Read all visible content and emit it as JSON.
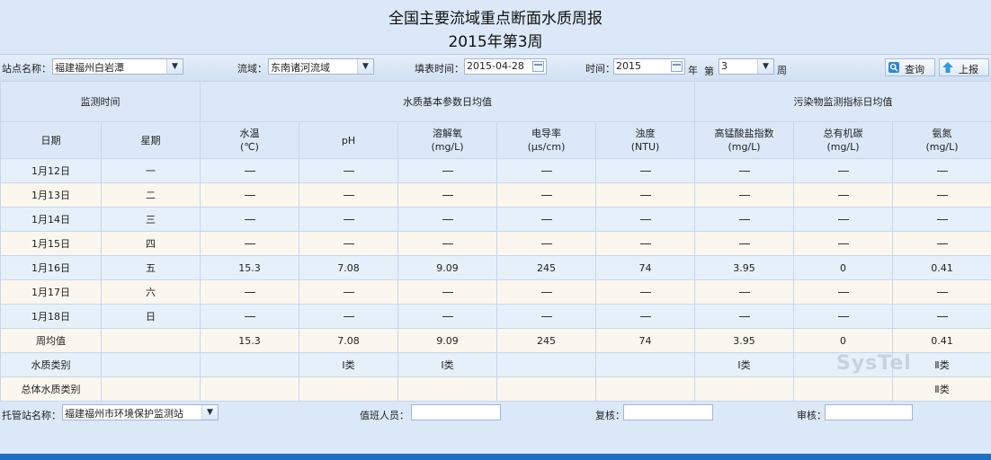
{
  "report": {
    "title": "全国主要流域重点断面水质周报",
    "subtitle": "2015年第3周"
  },
  "toolbar": {
    "station_label": "站点名称：",
    "station_value": "福建福州白岩潭",
    "basin_label": "流域：",
    "basin_value": "东南诸河流域",
    "fill_time_label": "填表时间：",
    "fill_time_value": "2015-04-28",
    "time_label": "时间：",
    "year_value": "2015",
    "year_unit": "年",
    "week_prefix": "第",
    "week_value": "3",
    "week_unit": "周",
    "query_label": "查询",
    "report_label": "上报"
  },
  "table": {
    "group_headers": [
      "监测时间",
      "水质基本参数日均值",
      "污染物监测指标日均值"
    ],
    "columns": [
      {
        "name": "日期",
        "unit": ""
      },
      {
        "name": "星期",
        "unit": ""
      },
      {
        "name": "水温",
        "unit": "(℃)"
      },
      {
        "name": "pH",
        "unit": ""
      },
      {
        "name": "溶解氧",
        "unit": "(mg/L)"
      },
      {
        "name": "电导率",
        "unit": "(μs/cm)"
      },
      {
        "name": "浊度",
        "unit": "(NTU)"
      },
      {
        "name": "高锰酸盐指数",
        "unit": "(mg/L)"
      },
      {
        "name": "总有机碳",
        "unit": "(mg/L)"
      },
      {
        "name": "氨氮",
        "unit": "(mg/L)"
      }
    ],
    "rows": [
      {
        "date": "1月12日",
        "weekday": "一",
        "values": [
          "—",
          "—",
          "—",
          "—",
          "—",
          "—",
          "—",
          "—"
        ]
      },
      {
        "date": "1月13日",
        "weekday": "二",
        "values": [
          "—",
          "—",
          "—",
          "—",
          "—",
          "—",
          "—",
          "—"
        ]
      },
      {
        "date": "1月14日",
        "weekday": "三",
        "values": [
          "—",
          "—",
          "—",
          "—",
          "—",
          "—",
          "—",
          "—"
        ]
      },
      {
        "date": "1月15日",
        "weekday": "四",
        "values": [
          "—",
          "—",
          "—",
          "—",
          "—",
          "—",
          "—",
          "—"
        ]
      },
      {
        "date": "1月16日",
        "weekday": "五",
        "values": [
          "15.3",
          "7.08",
          "9.09",
          "245",
          "74",
          "3.95",
          "0",
          "0.41"
        ]
      },
      {
        "date": "1月17日",
        "weekday": "六",
        "values": [
          "—",
          "—",
          "—",
          "—",
          "—",
          "—",
          "—",
          "—"
        ]
      },
      {
        "date": "1月18日",
        "weekday": "日",
        "values": [
          "—",
          "—",
          "—",
          "—",
          "—",
          "—",
          "—",
          "—"
        ]
      }
    ],
    "summary_rows": [
      {
        "label": "周均值",
        "values": [
          "15.3",
          "7.08",
          "9.09",
          "245",
          "74",
          "3.95",
          "0",
          "0.41"
        ]
      },
      {
        "label": "水质类别",
        "values": [
          "",
          "Ⅰ类",
          "Ⅰ类",
          "",
          "",
          "Ⅰ类",
          "",
          "Ⅱ类"
        ]
      },
      {
        "label": "总体水质类别",
        "values": [
          "",
          "",
          "",
          "",
          "",
          "",
          "",
          "Ⅱ类"
        ]
      }
    ]
  },
  "footer": {
    "host_label": "托管站名称：",
    "host_value": "福建福州市环境保护监测站",
    "duty_label": "值班人员：",
    "review_label": "复核：",
    "audit_label": "审核："
  },
  "watermark": "SysTel",
  "colors": {
    "page_bg": "#dbe8f8",
    "odd_row": "#e6f0fb",
    "even_row": "#fbf7ee",
    "border": "#c7d6ea",
    "accent": "#1f6fc0"
  }
}
